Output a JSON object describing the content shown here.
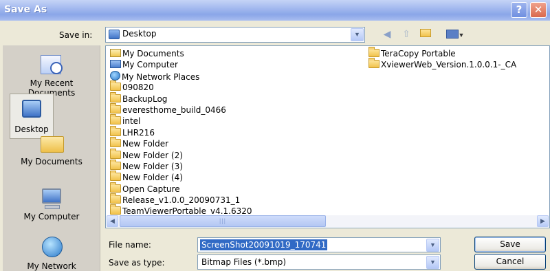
{
  "window": {
    "title": "Save As",
    "help_label": "?",
    "close_label": "✕"
  },
  "save_in": {
    "label": "Save in:",
    "value": "Desktop"
  },
  "places": [
    {
      "label_lines": [
        "My Recent",
        "Documents"
      ],
      "icon": "recent-documents-icon"
    },
    {
      "label_lines": [
        "Desktop"
      ],
      "icon": "desktop-icon",
      "selected": true
    },
    {
      "label_lines": [
        "My Documents"
      ],
      "icon": "my-documents-icon"
    },
    {
      "label_lines": [
        "My Computer"
      ],
      "icon": "my-computer-icon"
    },
    {
      "label_lines": [
        "My Network"
      ],
      "icon": "my-network-icon"
    }
  ],
  "files_col1": [
    {
      "name": "My Documents",
      "icon": "my-documents"
    },
    {
      "name": "My Computer",
      "icon": "my-computer"
    },
    {
      "name": "My Network Places",
      "icon": "network-places"
    },
    {
      "name": "090820",
      "icon": "folder"
    },
    {
      "name": "BackupLog",
      "icon": "folder"
    },
    {
      "name": "everesthome_build_0466",
      "icon": "folder"
    },
    {
      "name": "intel",
      "icon": "folder"
    },
    {
      "name": "LHR216",
      "icon": "folder"
    },
    {
      "name": "New Folder",
      "icon": "folder"
    },
    {
      "name": "New Folder (2)",
      "icon": "folder"
    },
    {
      "name": "New Folder (3)",
      "icon": "folder"
    },
    {
      "name": "New Folder (4)",
      "icon": "folder"
    },
    {
      "name": "Open Capture",
      "icon": "folder"
    },
    {
      "name": "Release_v1.0.0_20090731_1",
      "icon": "folder"
    },
    {
      "name": "TeamViewerPortable_v4.1.6320",
      "icon": "folder"
    }
  ],
  "files_col2": [
    {
      "name": "TeraCopy Portable",
      "icon": "folder"
    },
    {
      "name": "XviewerWeb_Version.1.0.0.1-_CA",
      "icon": "folder"
    }
  ],
  "file_name": {
    "label": "File name:",
    "value": "ScreenShot20091019_170741"
  },
  "save_as_type": {
    "label": "Save as type:",
    "value": "Bitmap Files (*.bmp)"
  },
  "buttons": {
    "save": "Save",
    "cancel": "Cancel"
  }
}
